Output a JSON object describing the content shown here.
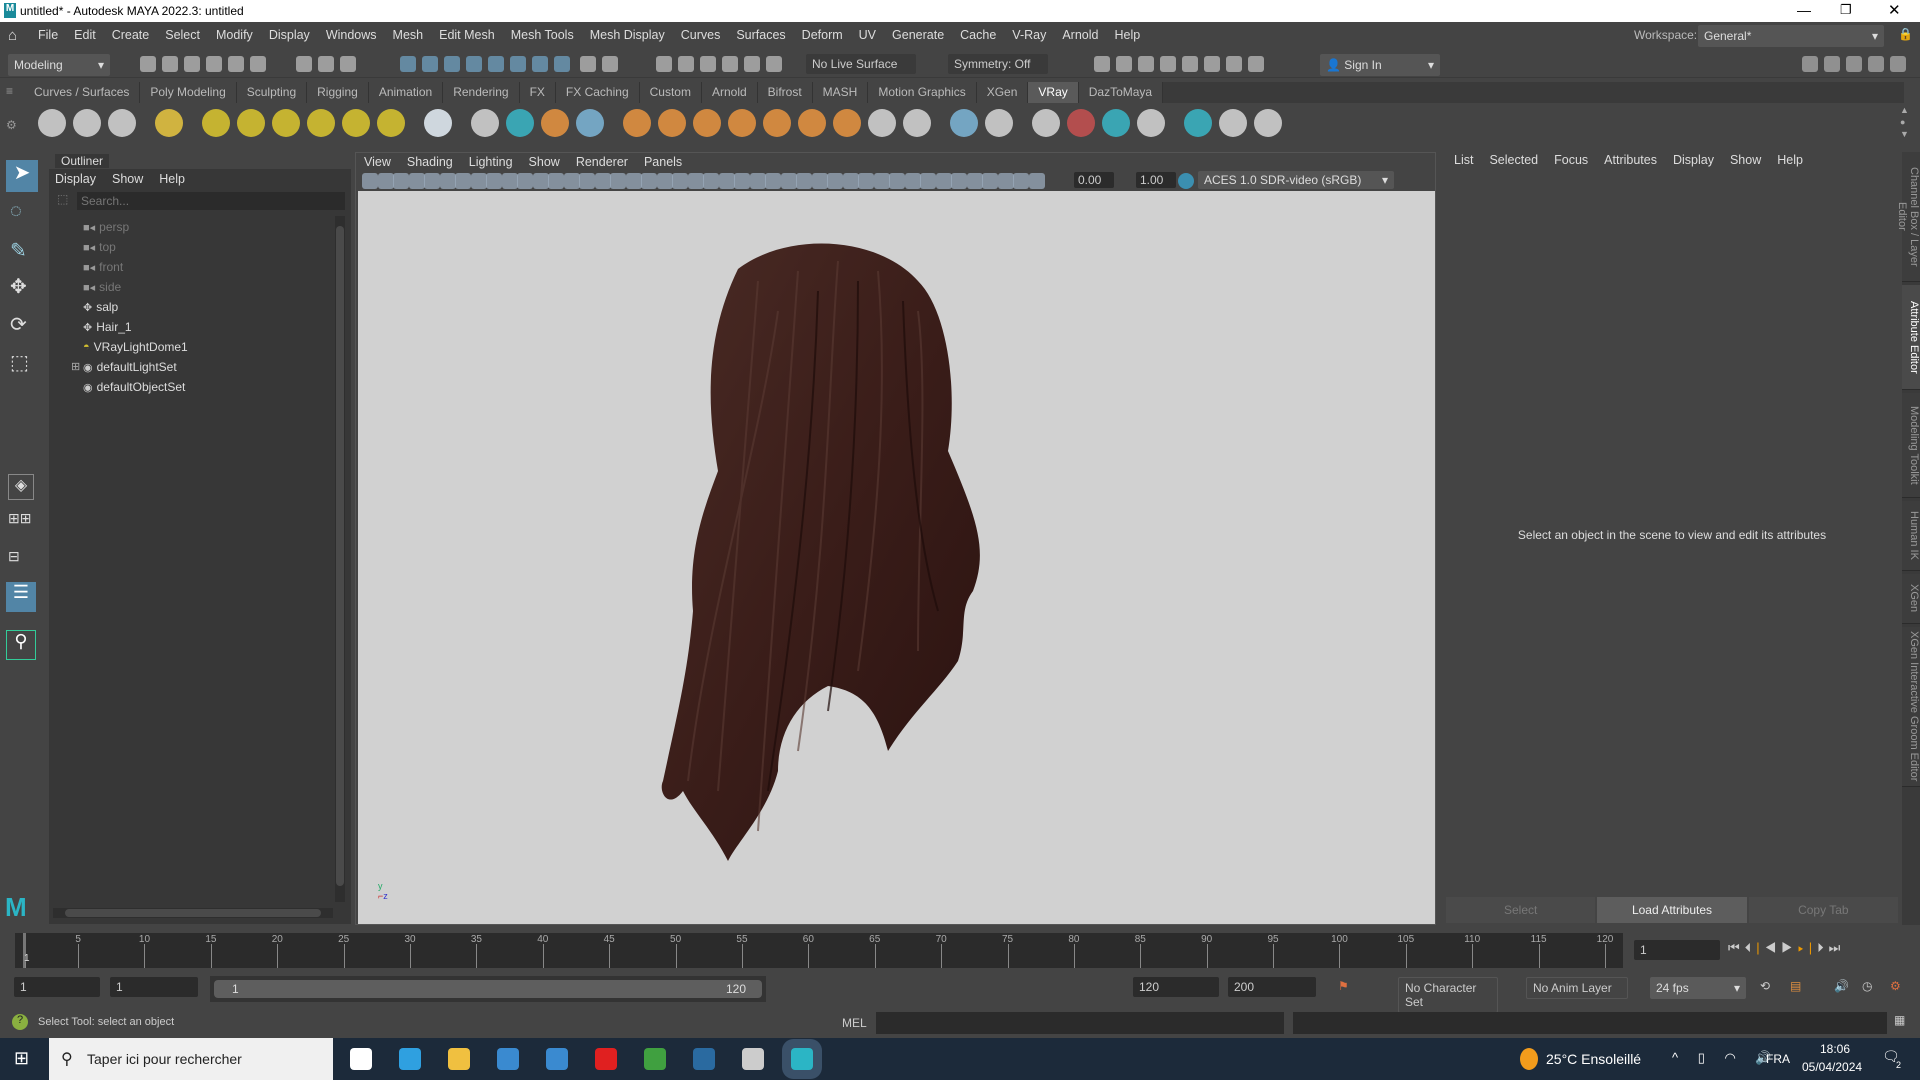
{
  "window": {
    "title": "untitled* - Autodesk MAYA 2022.3: untitled"
  },
  "menubar": [
    "File",
    "Edit",
    "Create",
    "Select",
    "Modify",
    "Display",
    "Windows",
    "Mesh",
    "Edit Mesh",
    "Mesh Tools",
    "Mesh Display",
    "Curves",
    "Surfaces",
    "Deform",
    "UV",
    "Generate",
    "Cache",
    "V-Ray",
    "Arnold",
    "Help"
  ],
  "workspace": {
    "label": "Workspace:",
    "value": "General*"
  },
  "statusline": {
    "mode": "Modeling",
    "live_surface": "No Live Surface",
    "symmetry": "Symmetry: Off",
    "sign_in": "Sign In"
  },
  "shelf_tabs": [
    "Curves / Surfaces",
    "Poly Modeling",
    "Sculpting",
    "Rigging",
    "Animation",
    "Rendering",
    "FX",
    "FX Caching",
    "Custom",
    "Arnold",
    "Bifrost",
    "MASH",
    "Motion Graphics",
    "XGen",
    "VRay",
    "DazToMaya"
  ],
  "shelf_active": "VRay",
  "shelf_icons": [
    {
      "name": "vray-asset-editor-icon",
      "color": "#cfcfcf"
    },
    {
      "name": "vray-render-icon",
      "color": "#cfcfcf"
    },
    {
      "name": "vray-ipr-icon",
      "color": "#cfcfcf"
    },
    {
      "name": "vray-frame-buffer-icon",
      "color": "#e0c040"
    },
    {
      "name": "dome-light-icon",
      "color": "#d4c030"
    },
    {
      "name": "rect-light-icon",
      "color": "#d4c030"
    },
    {
      "name": "sphere-light-icon",
      "color": "#d4c030"
    },
    {
      "name": "mesh-light-icon",
      "color": "#d4c030"
    },
    {
      "name": "ies-light-icon",
      "color": "#d4c030"
    },
    {
      "name": "sun-light-icon",
      "color": "#d4c030"
    },
    {
      "name": "plane-icon",
      "color": "#dfe8f0"
    },
    {
      "name": "proxy-export-icon",
      "color": "#cfcfcf"
    },
    {
      "name": "proxy-import-icon",
      "color": "#3ab0c0"
    },
    {
      "name": "scene-export-icon",
      "color": "#e09040"
    },
    {
      "name": "volume-grid-icon",
      "color": "#7ab0d0"
    },
    {
      "name": "fur-icon",
      "color": "#e09040"
    },
    {
      "name": "displacement-icon",
      "color": "#e09040"
    },
    {
      "name": "grass-icon",
      "color": "#e09040"
    },
    {
      "name": "clipper-icon",
      "color": "#e09040"
    },
    {
      "name": "decal-icon",
      "color": "#e09040"
    },
    {
      "name": "instancer-icon",
      "color": "#e09040"
    },
    {
      "name": "material-icon",
      "color": "#e09040"
    },
    {
      "name": "toon-icon",
      "color": "#cfcfcf"
    },
    {
      "name": "settings-gear-icon",
      "color": "#cfcfcf"
    },
    {
      "name": "physical-camera-icon",
      "color": "#7ab0d0"
    },
    {
      "name": "denoiser-icon",
      "color": "#cfcfcf"
    },
    {
      "name": "object-properties-icon",
      "color": "#cfcfcf"
    },
    {
      "name": "material-preview-icon",
      "color": "#c05050"
    },
    {
      "name": "multi-material-icon",
      "color": "#3ab0c0"
    },
    {
      "name": "palette-icon",
      "color": "#cfcfcf"
    },
    {
      "name": "region-render-icon",
      "color": "#3ab0c0"
    },
    {
      "name": "plug-icon",
      "color": "#cfcfcf"
    },
    {
      "name": "vray-logo-icon",
      "color": "#cfcfcf"
    }
  ],
  "outliner": {
    "title": "Outliner",
    "menus": [
      "Display",
      "Show",
      "Help"
    ],
    "search_placeholder": "Search...",
    "items": [
      {
        "label": "persp",
        "type": "camera",
        "dim": true
      },
      {
        "label": "top",
        "type": "camera",
        "dim": true
      },
      {
        "label": "front",
        "type": "camera",
        "dim": true
      },
      {
        "label": "side",
        "type": "camera",
        "dim": true
      },
      {
        "label": "salp",
        "type": "transform",
        "dim": false
      },
      {
        "label": "Hair_1",
        "type": "transform",
        "dim": false
      },
      {
        "label": "VRayLightDome1",
        "type": "light",
        "dim": false
      },
      {
        "label": "defaultLightSet",
        "type": "set",
        "dim": false,
        "expandable": true
      },
      {
        "label": "defaultObjectSet",
        "type": "set",
        "dim": false
      }
    ]
  },
  "viewport": {
    "menus": [
      "View",
      "Shading",
      "Lighting",
      "Show",
      "Renderer",
      "Panels"
    ],
    "exposure": "0.00",
    "gamma": "1.00",
    "color_space": "ACES 1.0 SDR-video (sRGB)"
  },
  "attribute_editor": {
    "menus": [
      "List",
      "Selected",
      "Focus",
      "Attributes",
      "Display",
      "Show",
      "Help"
    ],
    "message": "Select an object in the scene to view and edit its attributes",
    "buttons": [
      "Select",
      "Load Attributes",
      "Copy Tab"
    ]
  },
  "side_tabs": [
    "Channel Box / Layer Editor",
    "Attribute Editor",
    "Modeling Toolkit",
    "Human IK",
    "XGen",
    "XGen Interactive Groom Editor"
  ],
  "timeline": {
    "ticks": [
      5,
      10,
      15,
      20,
      25,
      30,
      35,
      40,
      45,
      50,
      55,
      60,
      65,
      70,
      75,
      80,
      85,
      90,
      95,
      100,
      105,
      110,
      115,
      120
    ],
    "start": 1,
    "end": 120,
    "current_frame_marker": "1",
    "current_frame": "1"
  },
  "range": {
    "start": "1",
    "playback_start": "1",
    "slider_start": "1",
    "slider_end": "120",
    "playback_end": "120",
    "end": "200",
    "character_set": "No Character Set",
    "anim_layer": "No Anim Layer",
    "fps": "24 fps"
  },
  "command": {
    "status": "Select Tool: select an object",
    "lang": "MEL"
  },
  "taskbar": {
    "search_placeholder": "Taper ici pour rechercher",
    "weather": "25°C  Ensoleillé",
    "lang": "FRA",
    "time": "18:06",
    "date": "05/04/2024",
    "notifications": "2"
  }
}
